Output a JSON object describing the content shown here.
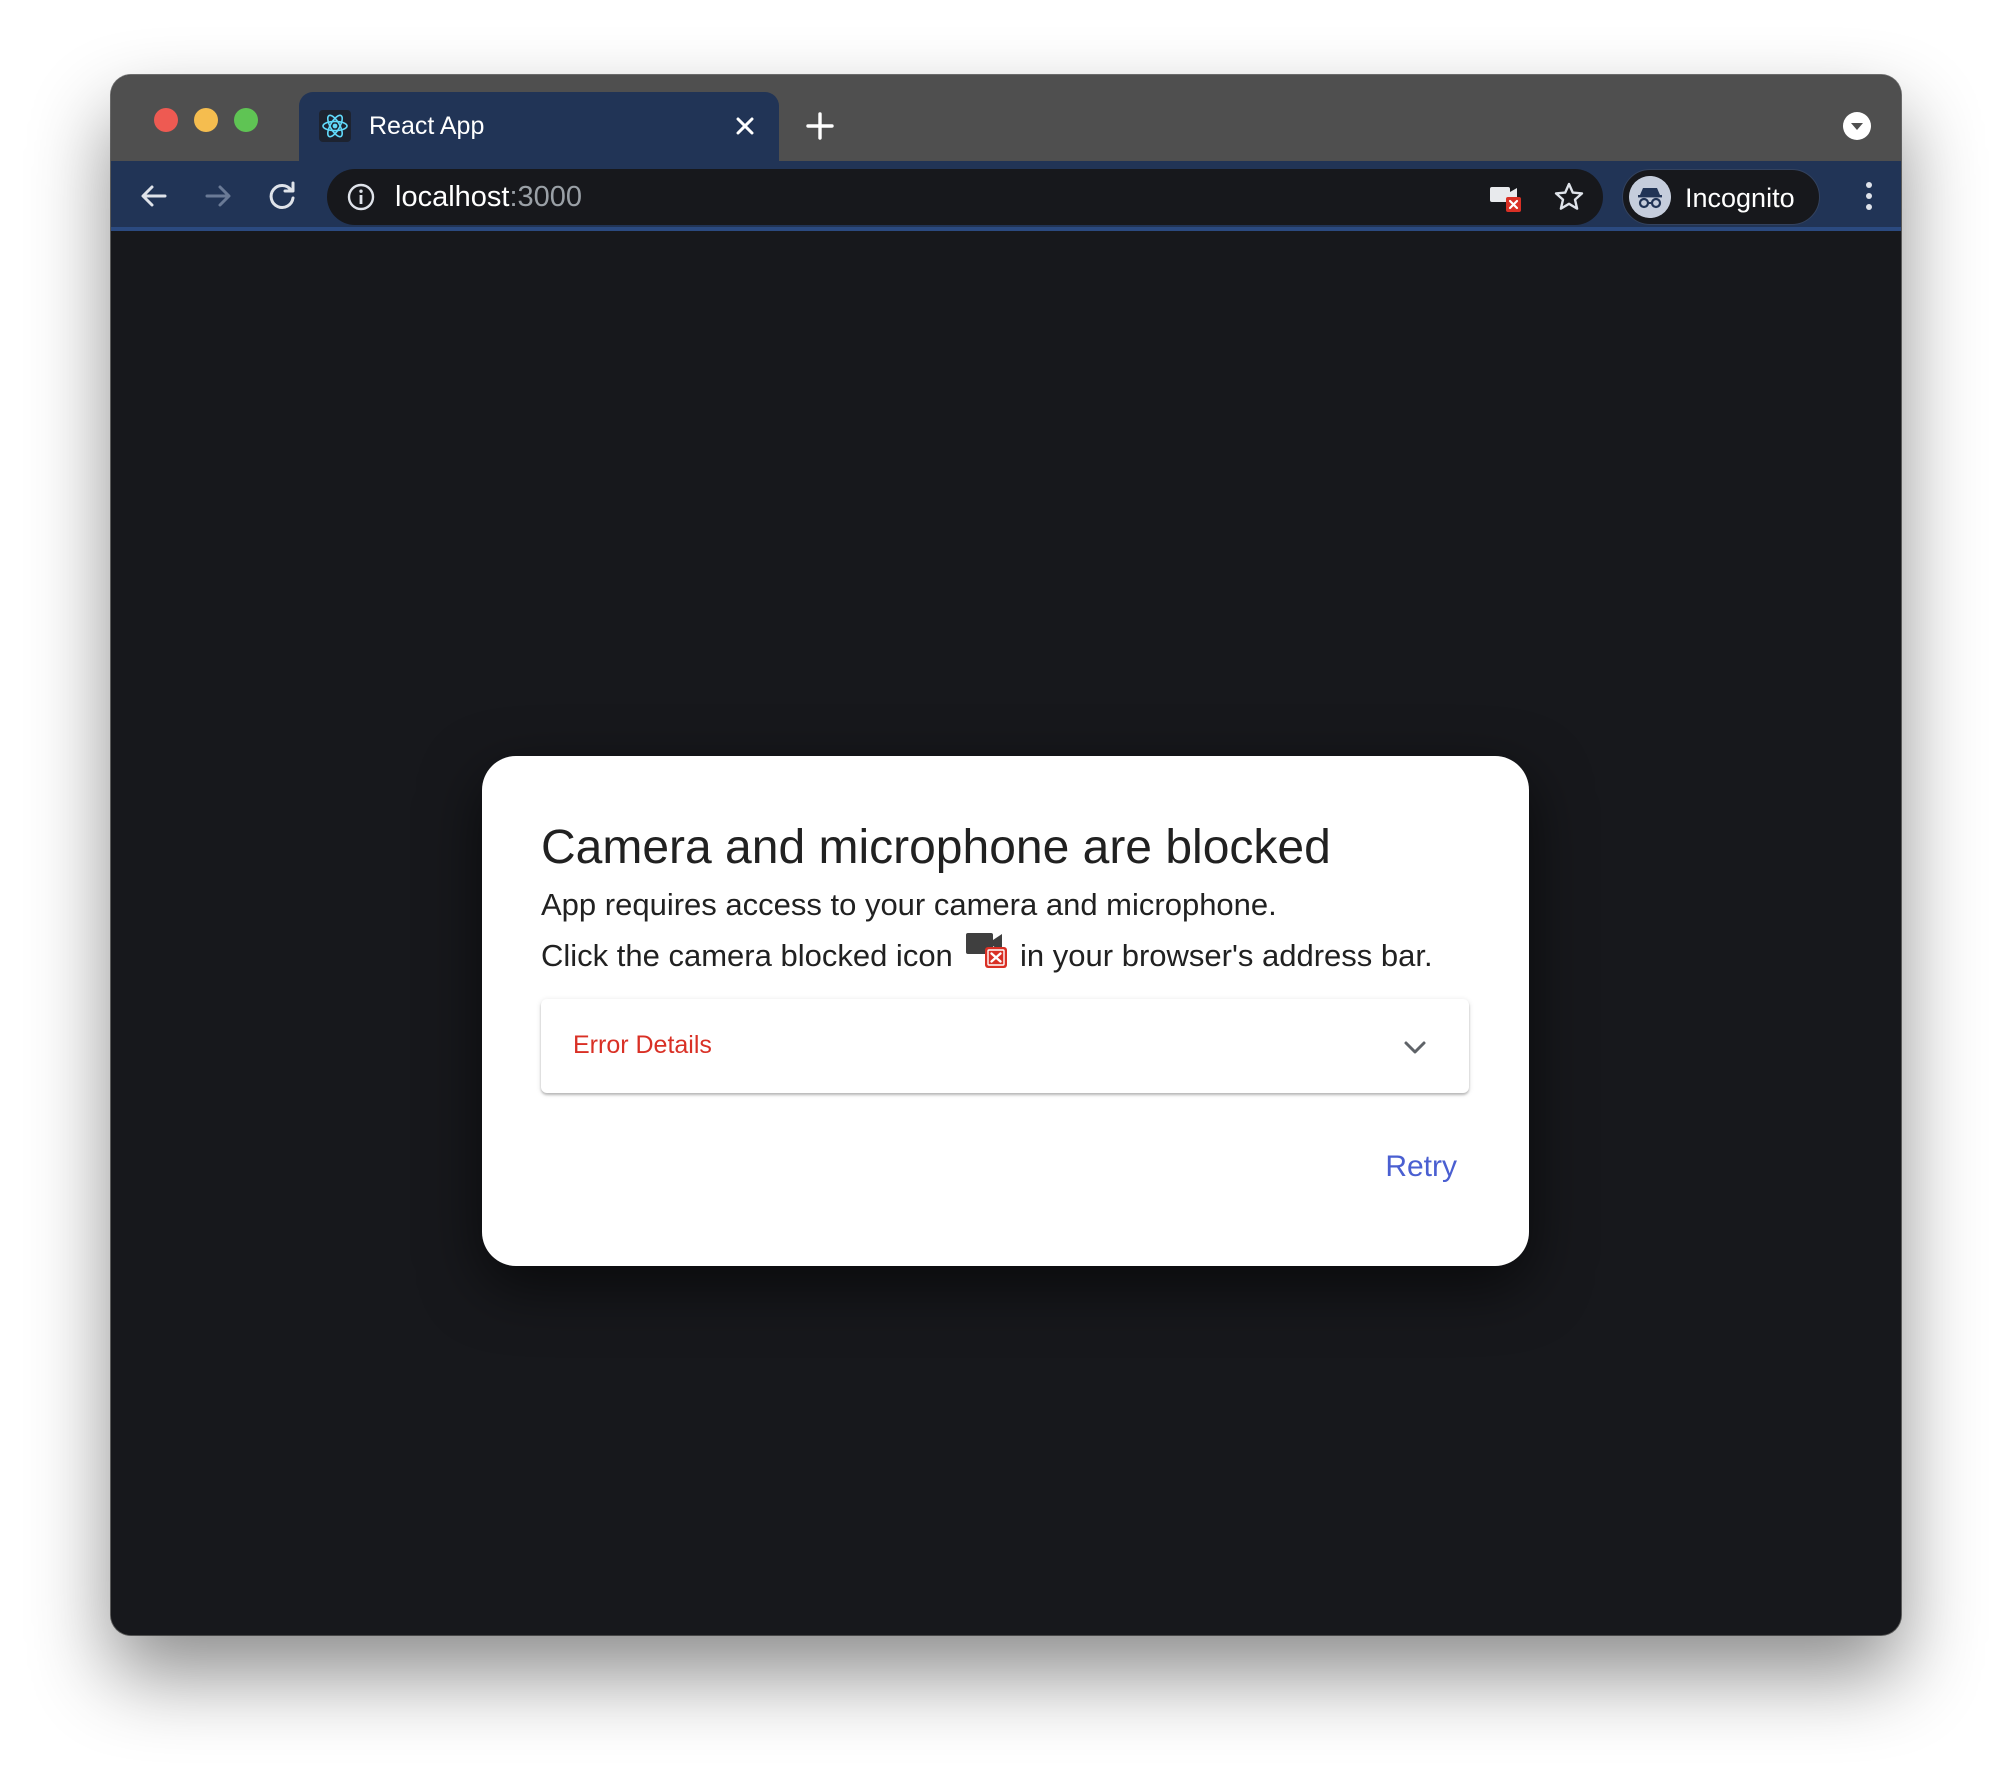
{
  "browser": {
    "tab_title": "React App",
    "url_host": "localhost",
    "url_port": ":3000",
    "profile_label": "Incognito",
    "theme_color": "#213456"
  },
  "dialog": {
    "title": "Camera and microphone are blocked",
    "line1": "App requires access to your camera and microphone.",
    "line2_before": "Click the camera blocked icon",
    "line2_after": "in your browser's address bar.",
    "accordion_label": "Error Details",
    "retry_label": "Retry",
    "error_color": "#d93025",
    "accent_color": "#4a5fd1"
  },
  "icons": {
    "favicon": "react-logo-icon",
    "omnibox_left": "info-icon",
    "omnibox_right": [
      "camera-blocked-icon",
      "star-icon"
    ],
    "accordion": "chevron-down-icon"
  }
}
